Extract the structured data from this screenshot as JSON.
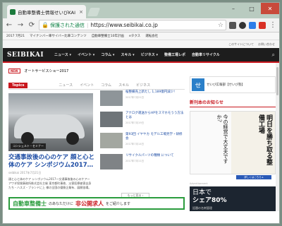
{
  "browser": {
    "tab_title": "自動車整備士情報せいびKAI",
    "tab_close": "×",
    "secure_label": "保護された通信",
    "url": "https://www.seibikai.co.jp",
    "win_min": "–",
    "win_max": "□",
    "win_close": "✕"
  },
  "bookmarks": [
    "2017 7月21",
    "マイナンバー車サイバー比車コンテンツ",
    "自動車整備士10年計画",
    "eタクス",
    "運転会社"
  ],
  "site": {
    "top_links": [
      "このサイトについて",
      "お問い合わせ"
    ],
    "logo": "SEIBIKAI",
    "nav": [
      "ニュース ▾",
      "イベント ▾",
      "コラム ▾",
      "スキル ▾",
      "ビジネス ▾",
      "整備工場レポ",
      "自動車リサイクル"
    ],
    "ticker_label": "NEW",
    "ticker_text": "オートサービスショー2017",
    "tabs": [
      "Topics",
      "ニュース",
      "イベント",
      "コラム",
      "スキル",
      "ビジネス"
    ],
    "main": {
      "tag": "コンシェルト・セミナー",
      "title": "交通事故後の心のケア 顔と心と体のケア シンポジウム2017…",
      "meta": "seibikai 2017年7月21日",
      "desc": "顔と心と体のケア シンポジウム2017～交通事故後の心のケア～ アワダ保険事務所株式会社主催 東京都町事故、災害医療被害自身たち・ハスズ・ブランドに上 様の全国の優勝企業有、展開協場。"
    },
    "articles": [
      {
        "text": "桜整備売上新たし 1,189億円減少!",
        "date": "2017年7月21日"
      },
      {
        "text": "アナログ運送からHPをスマホモうう方法とは",
        "date": "2017年7月19日"
      },
      {
        "text": "第93回 イヤヤカ モデル工場見学・研修会",
        "date": "2017年7月14日"
      },
      {
        "text": "リサイクルパーツの種類 について",
        "date": "2017年7月11日"
      }
    ],
    "more": "もっと見る ›",
    "side_ad": {
      "icon": "せ",
      "text": "せいび広報部【せいび塾】"
    },
    "new_book_title": "新刊本のお知らせ",
    "book": {
      "left": "今の経営で大丈夫ですか?",
      "right": "明日を勝ち取る整備工場",
      "detail": "詳しくはこちら ▸"
    },
    "ad_label": "Advertisement",
    "ad2": {
      "line1": "日本で",
      "line2": "シェア80%",
      "sub": "話題の名刺管理"
    },
    "banner": {
      "g": "自動車整備士",
      "s": "のあなただけに",
      "r": "非公開求人",
      "tail": "をご紹介します"
    }
  }
}
